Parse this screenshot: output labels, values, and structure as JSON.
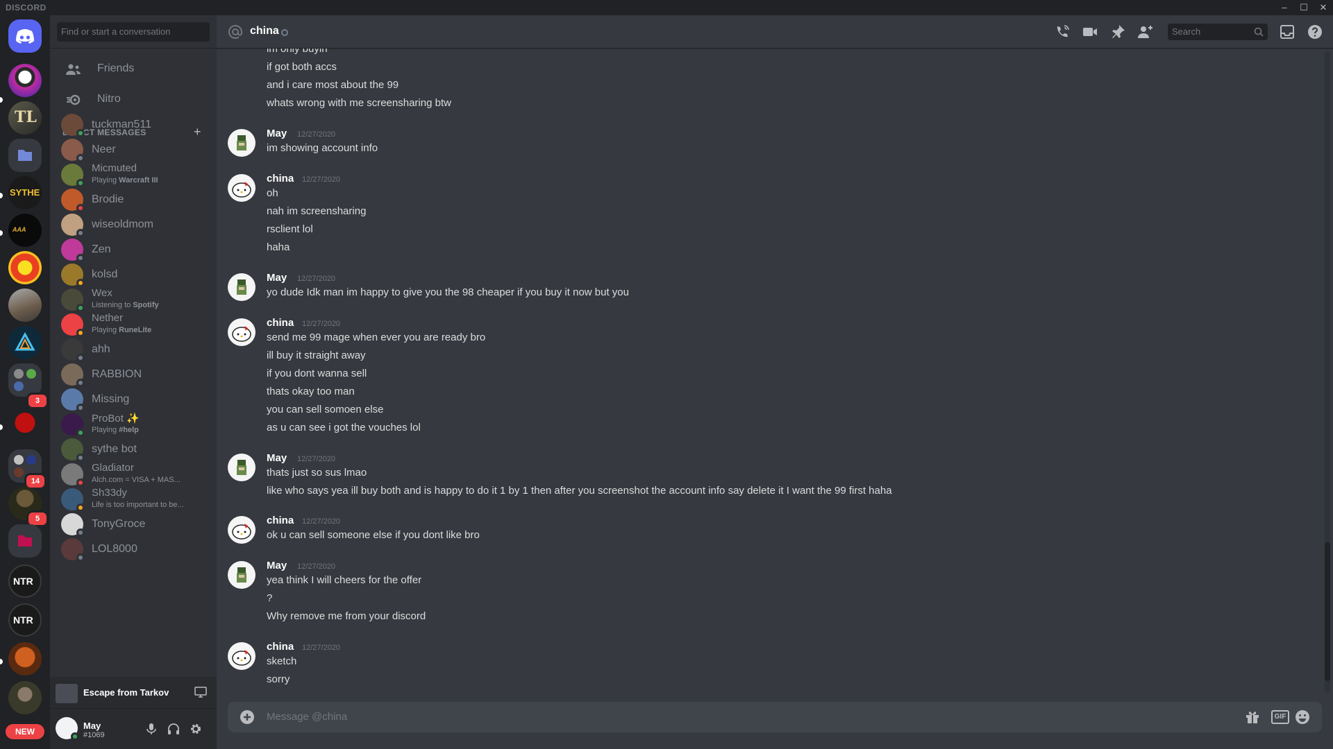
{
  "app": {
    "title": "DISCORD"
  },
  "rail": {
    "new_badge": "NEW",
    "badges": [
      "3",
      "14",
      "5"
    ],
    "labels": {
      "sythe": "SYTHE",
      "ntr": "NTR"
    }
  },
  "sidebar": {
    "search_placeholder": "Find or start a conversation",
    "nav": {
      "friends": "Friends",
      "nitro": "Nitro"
    },
    "dm_header": "DIRECT MESSAGES",
    "dms": [
      {
        "name": "tuckman511",
        "status": "online",
        "color": "#6b4a3a"
      },
      {
        "name": "Neer",
        "status": "offline",
        "color": "#8a5a4a"
      },
      {
        "name": "Micmuted",
        "status": "online",
        "activity_prefix": "Playing ",
        "activity": "Warcraft III",
        "color": "#6a7a3a"
      },
      {
        "name": "Brodie",
        "status": "dnd",
        "color": "#c05a2a"
      },
      {
        "name": "wiseoldmom",
        "status": "offline",
        "color": "#c0a080"
      },
      {
        "name": "Zen",
        "status": "offline",
        "color": "#c03a9a"
      },
      {
        "name": "kolsd",
        "status": "idle",
        "color": "#9a7a2a"
      },
      {
        "name": "Wex",
        "status": "online",
        "activity_prefix": "Listening to ",
        "activity": "Spotify",
        "color": "#4a4a3a"
      },
      {
        "name": "Nether",
        "status": "idle",
        "activity_prefix": "Playing ",
        "activity": "RuneLite",
        "color": "#ed4245"
      },
      {
        "name": "ahh",
        "status": "offline",
        "color": "#3a3a3a"
      },
      {
        "name": "RABBION",
        "status": "offline",
        "color": "#7a6a5a"
      },
      {
        "name": "Missing",
        "status": "offline",
        "color": "#5a7aaa"
      },
      {
        "name": "ProBot ✨",
        "status": "online",
        "activity_prefix": "Playing ",
        "activity": "#help",
        "color": "#3a1a4a"
      },
      {
        "name": "sythe bot",
        "status": "offline",
        "color": "#4a5a3a"
      },
      {
        "name": "Gladiator",
        "status": "dnd",
        "activity_prefix": "",
        "activity": "Alch.com = VISA + MAS...",
        "color": "#7a7a7a"
      },
      {
        "name": "Sh33dy",
        "status": "idle",
        "activity_prefix": "",
        "activity": "Life is too important to be...",
        "color": "#3a5a7a"
      },
      {
        "name": "TonyGroce",
        "status": "offline",
        "color": "#d8d8d8"
      },
      {
        "name": "LOL8000",
        "status": "offline",
        "color": "#5a3a3a"
      }
    ],
    "activity_game": "Escape from Tarkov",
    "user": {
      "name": "May",
      "tag": "#1069"
    }
  },
  "header": {
    "channel": "china",
    "search_placeholder": "Search"
  },
  "messages": {
    "continuation": [
      "im only buyin",
      "if got both accs",
      "and i care most about the 99",
      "whats wrong with me screensharing btw"
    ],
    "groups": [
      {
        "author": "May",
        "time": "12/27/2020",
        "lines": [
          "im showing account info"
        ]
      },
      {
        "author": "china",
        "time": "12/27/2020",
        "lines": [
          "oh",
          "nah im screensharing",
          "rsclient lol",
          "haha"
        ]
      },
      {
        "author": "May",
        "time": "12/27/2020",
        "lines": [
          "yo dude Idk man im happy to give you the 98 cheaper if you buy it now but you"
        ]
      },
      {
        "author": "china",
        "time": "12/27/2020",
        "lines": [
          "send me 99 mage when ever you are ready bro",
          "ill buy it straight away",
          "if you dont wanna sell",
          "thats okay too man",
          "you can sell somoen else",
          "as u can see i got the vouches lol"
        ]
      },
      {
        "author": "May",
        "time": "12/27/2020",
        "lines": [
          "thats just so sus lmao",
          "like who says yea ill buy both and is happy to do it 1 by 1 then after you screenshot the account info say delete it I want the 99 first haha"
        ]
      },
      {
        "author": "china",
        "time": "12/27/2020",
        "lines": [
          "ok u can sell someone else if you dont like bro"
        ]
      },
      {
        "author": "May",
        "time": "12/27/2020",
        "lines": [
          "yea think I will cheers for the offer",
          "?",
          "Why remove me from your discord"
        ]
      },
      {
        "author": "china",
        "time": "12/27/2020",
        "lines": [
          "sketch",
          "sorry"
        ]
      }
    ]
  },
  "composer": {
    "placeholder": "Message @china",
    "gif_label": "GIF"
  }
}
